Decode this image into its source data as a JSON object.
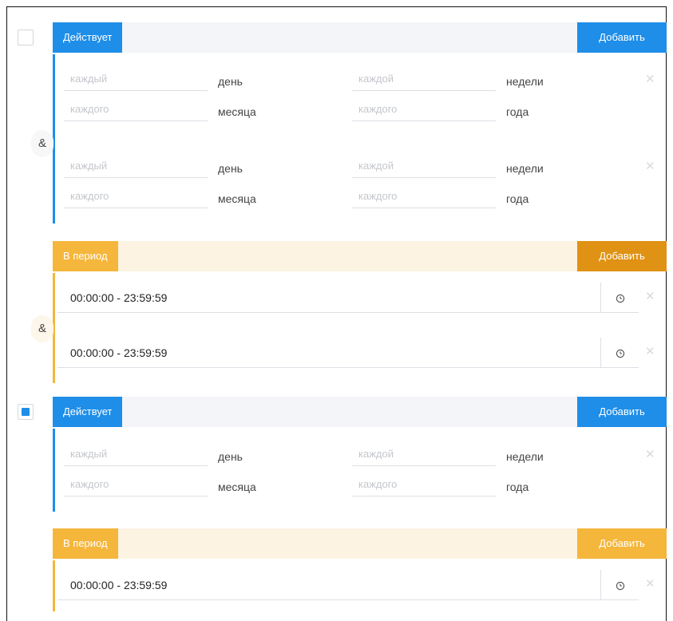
{
  "colors": {
    "blue": "#1e8ee8",
    "yellow": "#f5b63c",
    "dark_yellow": "#e09214"
  },
  "operators": {
    "and": "&"
  },
  "groups": [
    {
      "checked": false,
      "active": {
        "label": "Действует",
        "add_label": "Добавить",
        "rows": [
          {
            "day_placeholder": "каждый",
            "day_unit": "день",
            "week_placeholder": "каждой",
            "week_unit": "недели",
            "month_placeholder": "каждого",
            "month_unit": "месяца",
            "year_placeholder": "каждого",
            "year_unit": "года",
            "remove": "✕"
          },
          {
            "day_placeholder": "каждый",
            "day_unit": "день",
            "week_placeholder": "каждой",
            "week_unit": "недели",
            "month_placeholder": "каждого",
            "month_unit": "месяца",
            "year_placeholder": "каждого",
            "year_unit": "года",
            "remove": "✕"
          }
        ]
      },
      "period": {
        "label": "В период",
        "add_label": "Добавить",
        "times": [
          {
            "value": "00:00:00 - 23:59:59",
            "remove": "✕"
          },
          {
            "value": "00:00:00 - 23:59:59",
            "remove": "✕"
          }
        ]
      }
    },
    {
      "checked": true,
      "active": {
        "label": "Действует",
        "add_label": "Добавить",
        "rows": [
          {
            "day_placeholder": "каждый",
            "day_unit": "день",
            "week_placeholder": "каждой",
            "week_unit": "недели",
            "month_placeholder": "каждого",
            "month_unit": "месяца",
            "year_placeholder": "каждого",
            "year_unit": "года",
            "remove": "✕"
          }
        ]
      },
      "period": {
        "label": "В период",
        "add_label": "Добавить",
        "times": [
          {
            "value": "00:00:00 - 23:59:59",
            "remove": "✕"
          }
        ]
      }
    }
  ]
}
